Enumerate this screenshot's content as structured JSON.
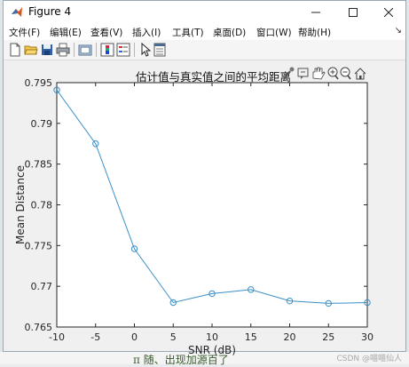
{
  "window": {
    "title": "Figure 4"
  },
  "menu": {
    "items": [
      "文件(F)",
      "编辑(E)",
      "查看(V)",
      "插入(I)",
      "工具(T)",
      "桌面(D)",
      "窗口(W)",
      "帮助(H)"
    ]
  },
  "axes_title": "估计值与真实值之间的平均距离",
  "background": {
    "text": "π    随、出现加源百了",
    "watermark": "CSDN @喵喵仙人"
  },
  "icons": {
    "toolbar": [
      "new-figure-icon",
      "open-file-icon",
      "save-icon",
      "print-icon",
      "link-plot-icon",
      "insert-colorbar-icon",
      "insert-legend-icon",
      "edit-plot-icon",
      "property-inspector-icon"
    ],
    "axes_toolbar": [
      "brush-icon",
      "data-tips-icon",
      "pan-icon",
      "zoom-in-icon",
      "zoom-out-icon",
      "home-icon"
    ]
  },
  "colors": {
    "series": "#3a8fc7",
    "axes_bg": "#ffffff",
    "figure_bg": "#f0f0f0"
  },
  "chart_data": {
    "type": "line",
    "title": "估计值与真实值之间的平均距离",
    "xlabel": "SNR (dB)",
    "ylabel": "Mean Distance",
    "xlim": [
      -10,
      30
    ],
    "ylim": [
      0.765,
      0.795
    ],
    "xticks": [
      -10,
      -5,
      0,
      5,
      10,
      15,
      20,
      25,
      30
    ],
    "yticks": [
      0.765,
      0.77,
      0.775,
      0.78,
      0.785,
      0.79,
      0.795
    ],
    "ytick_labels": [
      "0.765",
      "0.77",
      "0.775",
      "0.78",
      "0.785",
      "0.79",
      "0.795"
    ],
    "grid": false,
    "legend": "none",
    "series": [
      {
        "marker": "circle",
        "x": [
          -10,
          -5,
          0,
          5,
          10,
          15,
          20,
          25,
          30
        ],
        "y": [
          0.7941,
          0.7875,
          0.7746,
          0.768,
          0.7691,
          0.7696,
          0.7682,
          0.7679,
          0.768
        ]
      }
    ]
  }
}
